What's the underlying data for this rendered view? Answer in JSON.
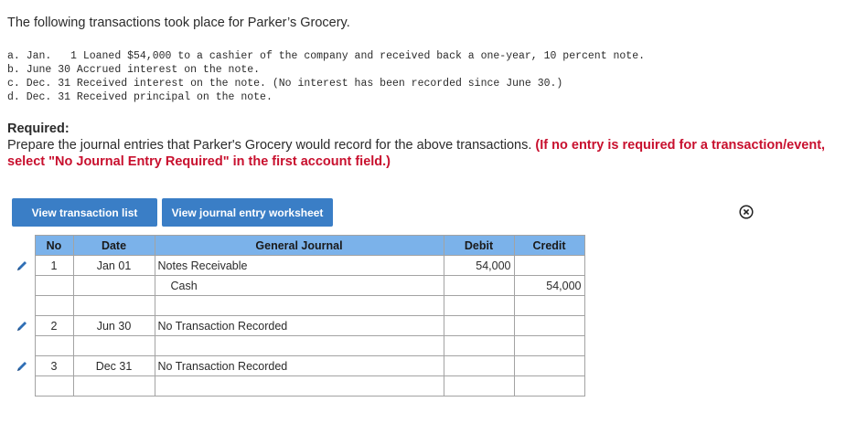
{
  "intro": "The following transactions took place for Parker’s Grocery.",
  "transactions": [
    "a. Jan.   1 Loaned $54,000 to a cashier of the company and received back a one-year, 10 percent note.",
    "b. June 30 Accrued interest on the note.",
    "c. Dec. 31 Received interest on the note. (No interest has been recorded since June 30.)",
    "d. Dec. 31 Received principal on the note."
  ],
  "required": {
    "heading": "Required:",
    "text": "Prepare the journal entries that Parker's Grocery would record for the above transactions. ",
    "instruction": "(If no entry is required for a transaction/event, select \"No Journal Entry Required\" in the first account field.)"
  },
  "buttons": {
    "transaction_list": "View transaction list",
    "journal_worksheet": "View journal entry worksheet"
  },
  "table": {
    "headers": {
      "no": "No",
      "date": "Date",
      "journal": "General Journal",
      "debit": "Debit",
      "credit": "Credit"
    },
    "rows": [
      {
        "no": "1",
        "date": "Jan 01",
        "account": "Notes Receivable",
        "debit": "54,000",
        "credit": "",
        "editable": true
      },
      {
        "no": "",
        "date": "",
        "account": "Cash",
        "debit": "",
        "credit": "54,000",
        "indent": true
      },
      {
        "no": "",
        "date": "",
        "account": "",
        "debit": "",
        "credit": ""
      },
      {
        "no": "2",
        "date": "Jun 30",
        "account": "No Transaction Recorded",
        "debit": "",
        "credit": "",
        "editable": true
      },
      {
        "no": "",
        "date": "",
        "account": "",
        "debit": "",
        "credit": ""
      },
      {
        "no": "3",
        "date": "Dec 31",
        "account": "No Transaction Recorded",
        "debit": "",
        "credit": "",
        "editable": true
      },
      {
        "no": "",
        "date": "",
        "account": "",
        "debit": "",
        "credit": ""
      }
    ]
  },
  "colors": {
    "button": "#3a7ec6",
    "header": "#7bb2ea",
    "required_red": "#c8102e"
  },
  "icons": {
    "close": "close-circle-icon",
    "edit": "pencil-icon"
  }
}
